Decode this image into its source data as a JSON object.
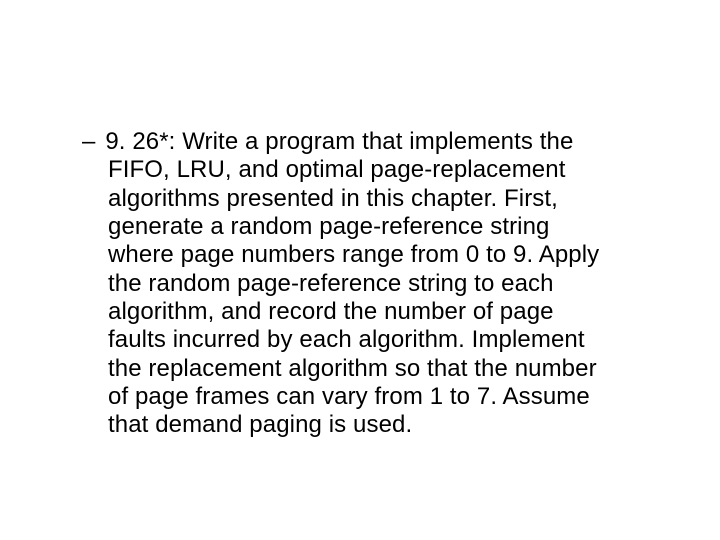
{
  "item": {
    "dash": "–",
    "line1_prefix": "9. 26*: Write a program that implements the",
    "line2_pre": "FIFO, LRU, ",
    "line2_mid": "and ",
    "line2_opt": "optimal ",
    "line2_post": "page-replacement",
    "line3": "algorithms presented in this chapter. First,",
    "line4": "generate a random page-reference string",
    "line5": "where page numbers range from 0 to 9. Apply",
    "line6": "the random page-reference string to each",
    "line7": "algorithm, and record the number of page",
    "line8": "faults incurred by each algorithm. Implement",
    "line9": "the replacement algorithm so that the number",
    "line10": "of page frames can vary from 1 to 7. Assume",
    "line11": "that demand paging is used."
  }
}
